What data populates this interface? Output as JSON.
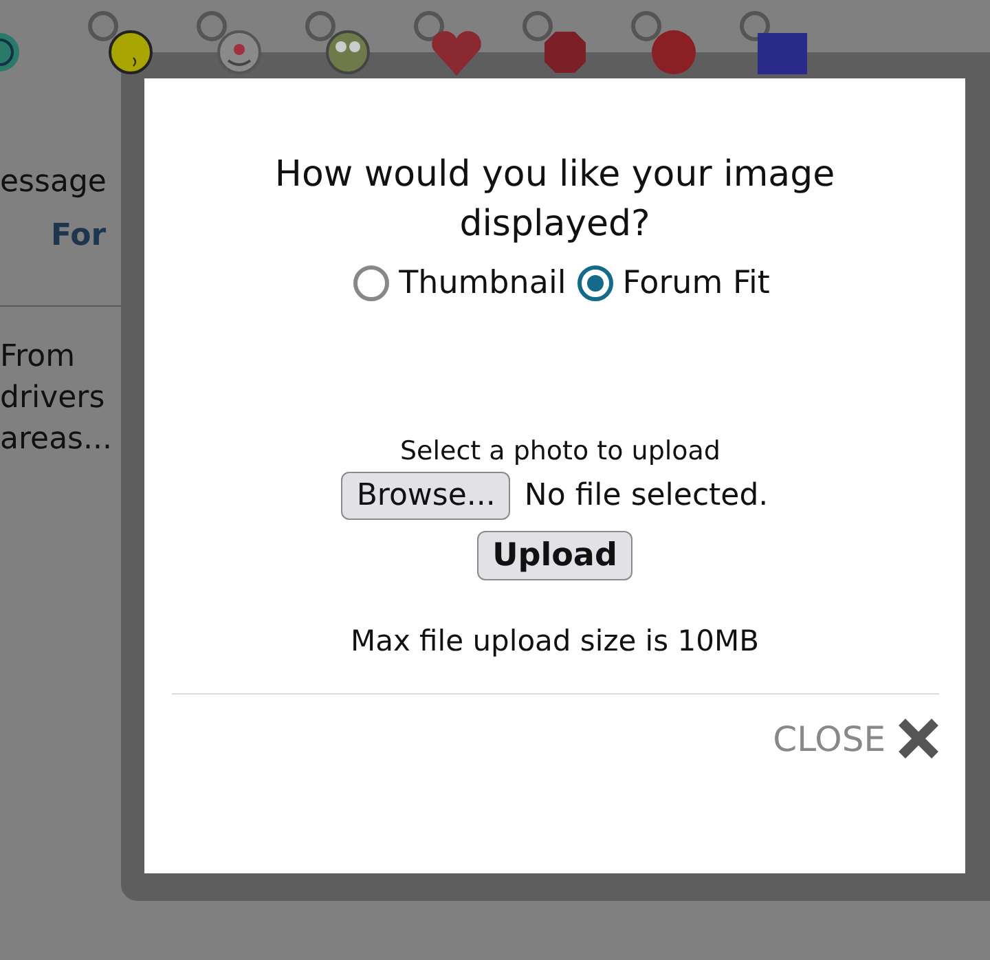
{
  "edge_emoticon": {
    "kind": "ring"
  },
  "emoticons": [
    {
      "kind": "smiley",
      "selected": false
    },
    {
      "kind": "clown",
      "selected": false
    },
    {
      "kind": "frog",
      "selected": false
    },
    {
      "kind": "heart",
      "selected": false
    },
    {
      "kind": "stop",
      "selected": false
    },
    {
      "kind": "badge",
      "selected": false
    },
    {
      "kind": "offtopic",
      "selected": false
    }
  ],
  "background": {
    "message_label": "essage",
    "format_label": "For",
    "post_lines": [
      "From",
      "drivers",
      "areas..."
    ]
  },
  "dialog": {
    "title": "How would you like your image displayed?",
    "display_options": [
      {
        "label": "Thumbnail",
        "selected": false
      },
      {
        "label": "Forum Fit",
        "selected": true
      }
    ],
    "upload_prompt": "Select a photo to upload",
    "browse_button": "Browse...",
    "file_status": "No file selected.",
    "upload_button": "Upload",
    "size_note": "Max file upload size is 10MB",
    "close_label": "CLOSE"
  }
}
